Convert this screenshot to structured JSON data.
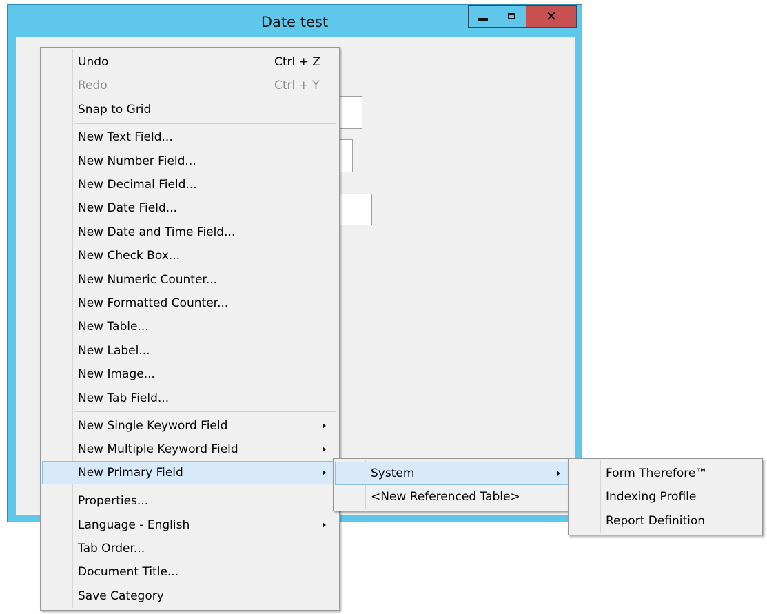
{
  "window": {
    "title": "Date test"
  },
  "menu": {
    "items": [
      {
        "label": "Undo",
        "shortcut": "Ctrl + Z"
      },
      {
        "label": "Redo",
        "shortcut": "Ctrl + Y"
      },
      {
        "label": "Snap to Grid"
      },
      {
        "label": "New Text Field..."
      },
      {
        "label": "New Number Field..."
      },
      {
        "label": "New Decimal Field..."
      },
      {
        "label": "New Date Field..."
      },
      {
        "label": "New Date and Time Field..."
      },
      {
        "label": "New Check Box..."
      },
      {
        "label": "New Numeric Counter..."
      },
      {
        "label": "New Formatted Counter..."
      },
      {
        "label": "New Table..."
      },
      {
        "label": "New Label..."
      },
      {
        "label": "New Image..."
      },
      {
        "label": "New Tab Field..."
      },
      {
        "label": "New Single Keyword Field"
      },
      {
        "label": "New Multiple Keyword Field"
      },
      {
        "label": "New Primary Field"
      },
      {
        "label": "Properties..."
      },
      {
        "label": "Language - English"
      },
      {
        "label": "Tab Order..."
      },
      {
        "label": "Document Title..."
      },
      {
        "label": "Save Category"
      }
    ]
  },
  "submenu": {
    "items": [
      {
        "label": "System"
      },
      {
        "label": "<New Referenced Table>"
      }
    ]
  },
  "subsubmenu": {
    "items": [
      {
        "label": "Form Therefore™"
      },
      {
        "label": "Indexing Profile"
      },
      {
        "label": "Report Definition"
      }
    ]
  }
}
